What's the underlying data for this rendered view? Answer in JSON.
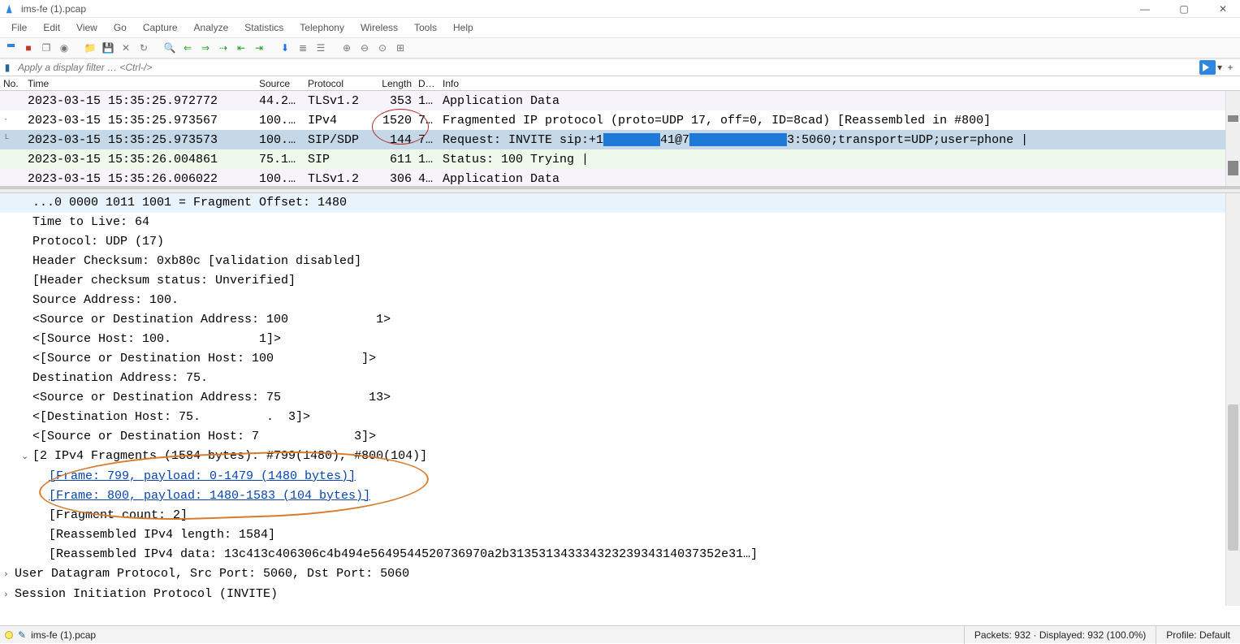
{
  "window": {
    "title": "ims-fe (1).pcap"
  },
  "menus": [
    "File",
    "Edit",
    "View",
    "Go",
    "Capture",
    "Analyze",
    "Statistics",
    "Telephony",
    "Wireless",
    "Tools",
    "Help"
  ],
  "filter": {
    "placeholder": "Apply a display filter … <Ctrl-/>"
  },
  "columns": [
    "No.",
    "Time",
    "Source",
    "Protocol",
    "Length",
    "Destin",
    "Info"
  ],
  "packets": [
    {
      "time": "2023-03-15 15:35:25.972772",
      "source": "44.2…",
      "protocol": "TLSv1.2",
      "length": "353",
      "destin": "1…",
      "info": "Application Data",
      "bg": "bg-purple",
      "marker": ""
    },
    {
      "time": "2023-03-15 15:35:25.973567",
      "source": "100.…",
      "protocol": "IPv4",
      "length": "1520",
      "destin": "7…",
      "info": "Fragmented IP protocol (proto=UDP 17, off=0, ID=8cad) [Reassembled in #800]",
      "bg": "bg-white",
      "marker": "·"
    },
    {
      "time": "2023-03-15 15:35:25.973573",
      "source": "100.…",
      "protocol": "SIP/SDP",
      "length": "144",
      "destin": "7…",
      "info_pre": "Request: INVITE sip:+1",
      "info_mid": "41@7",
      "info_post": "3:5060;transport=UDP;user=phone |",
      "bg": "bg-selected",
      "marker": "└",
      "redacted": true
    },
    {
      "time": "2023-03-15 15:35:26.004861",
      "source": "75.1…",
      "protocol": "SIP",
      "length": "611",
      "destin": "1…",
      "info": "Status: 100 Trying |",
      "bg": "bg-green",
      "marker": ""
    },
    {
      "time": "2023-03-15 15:35:26.006022",
      "source": "100.…",
      "protocol": "TLSv1.2",
      "length": "306",
      "destin": "4…",
      "info": "Application Data",
      "bg": "bg-purple",
      "marker": ""
    }
  ],
  "details": {
    "l0": "...0 0000 1011 1001 = Fragment Offset: 1480",
    "l1": "Time to Live: 64",
    "l2": "Protocol: UDP (17)",
    "l3": "Header Checksum: 0xb80c [validation disabled]",
    "l4": "[Header checksum status: Unverified]",
    "l5": "Source Address: 100.",
    "l6": "<Source or Destination Address: 100            1>",
    "l7": "<[Source Host: 100.            1]>",
    "l8": "<[Source or Destination Host: 100            ]>",
    "l9": "Destination Address: 75.",
    "l10": "<Source or Destination Address: 75            13>",
    "l11": "<[Destination Host: 75.         .  3]>",
    "l12": "<[Source or Destination Host: 7             3]>",
    "l13": "[2 IPv4 Fragments (1584 bytes): #799(1480), #800(104)]",
    "l14": "[Frame: 799, payload: 0-1479 (1480 bytes)]",
    "l15": "[Frame: 800, payload: 1480-1583 (104 bytes)]",
    "l16": "[Fragment count: 2]",
    "l17": "[Reassembled IPv4 length: 1584]",
    "l18": "[Reassembled IPv4 data: 13c413c406306c4b494e5649544520736970a2b31353134333432323934314037352e31…]",
    "l19": "User Datagram Protocol, Src Port: 5060, Dst Port: 5060",
    "l20": "Session Initiation Protocol (INVITE)"
  },
  "statusbar": {
    "file": "ims-fe (1).pcap",
    "packets": "Packets: 932 · Displayed: 932 (100.0%)",
    "profile": "Profile: Default"
  }
}
